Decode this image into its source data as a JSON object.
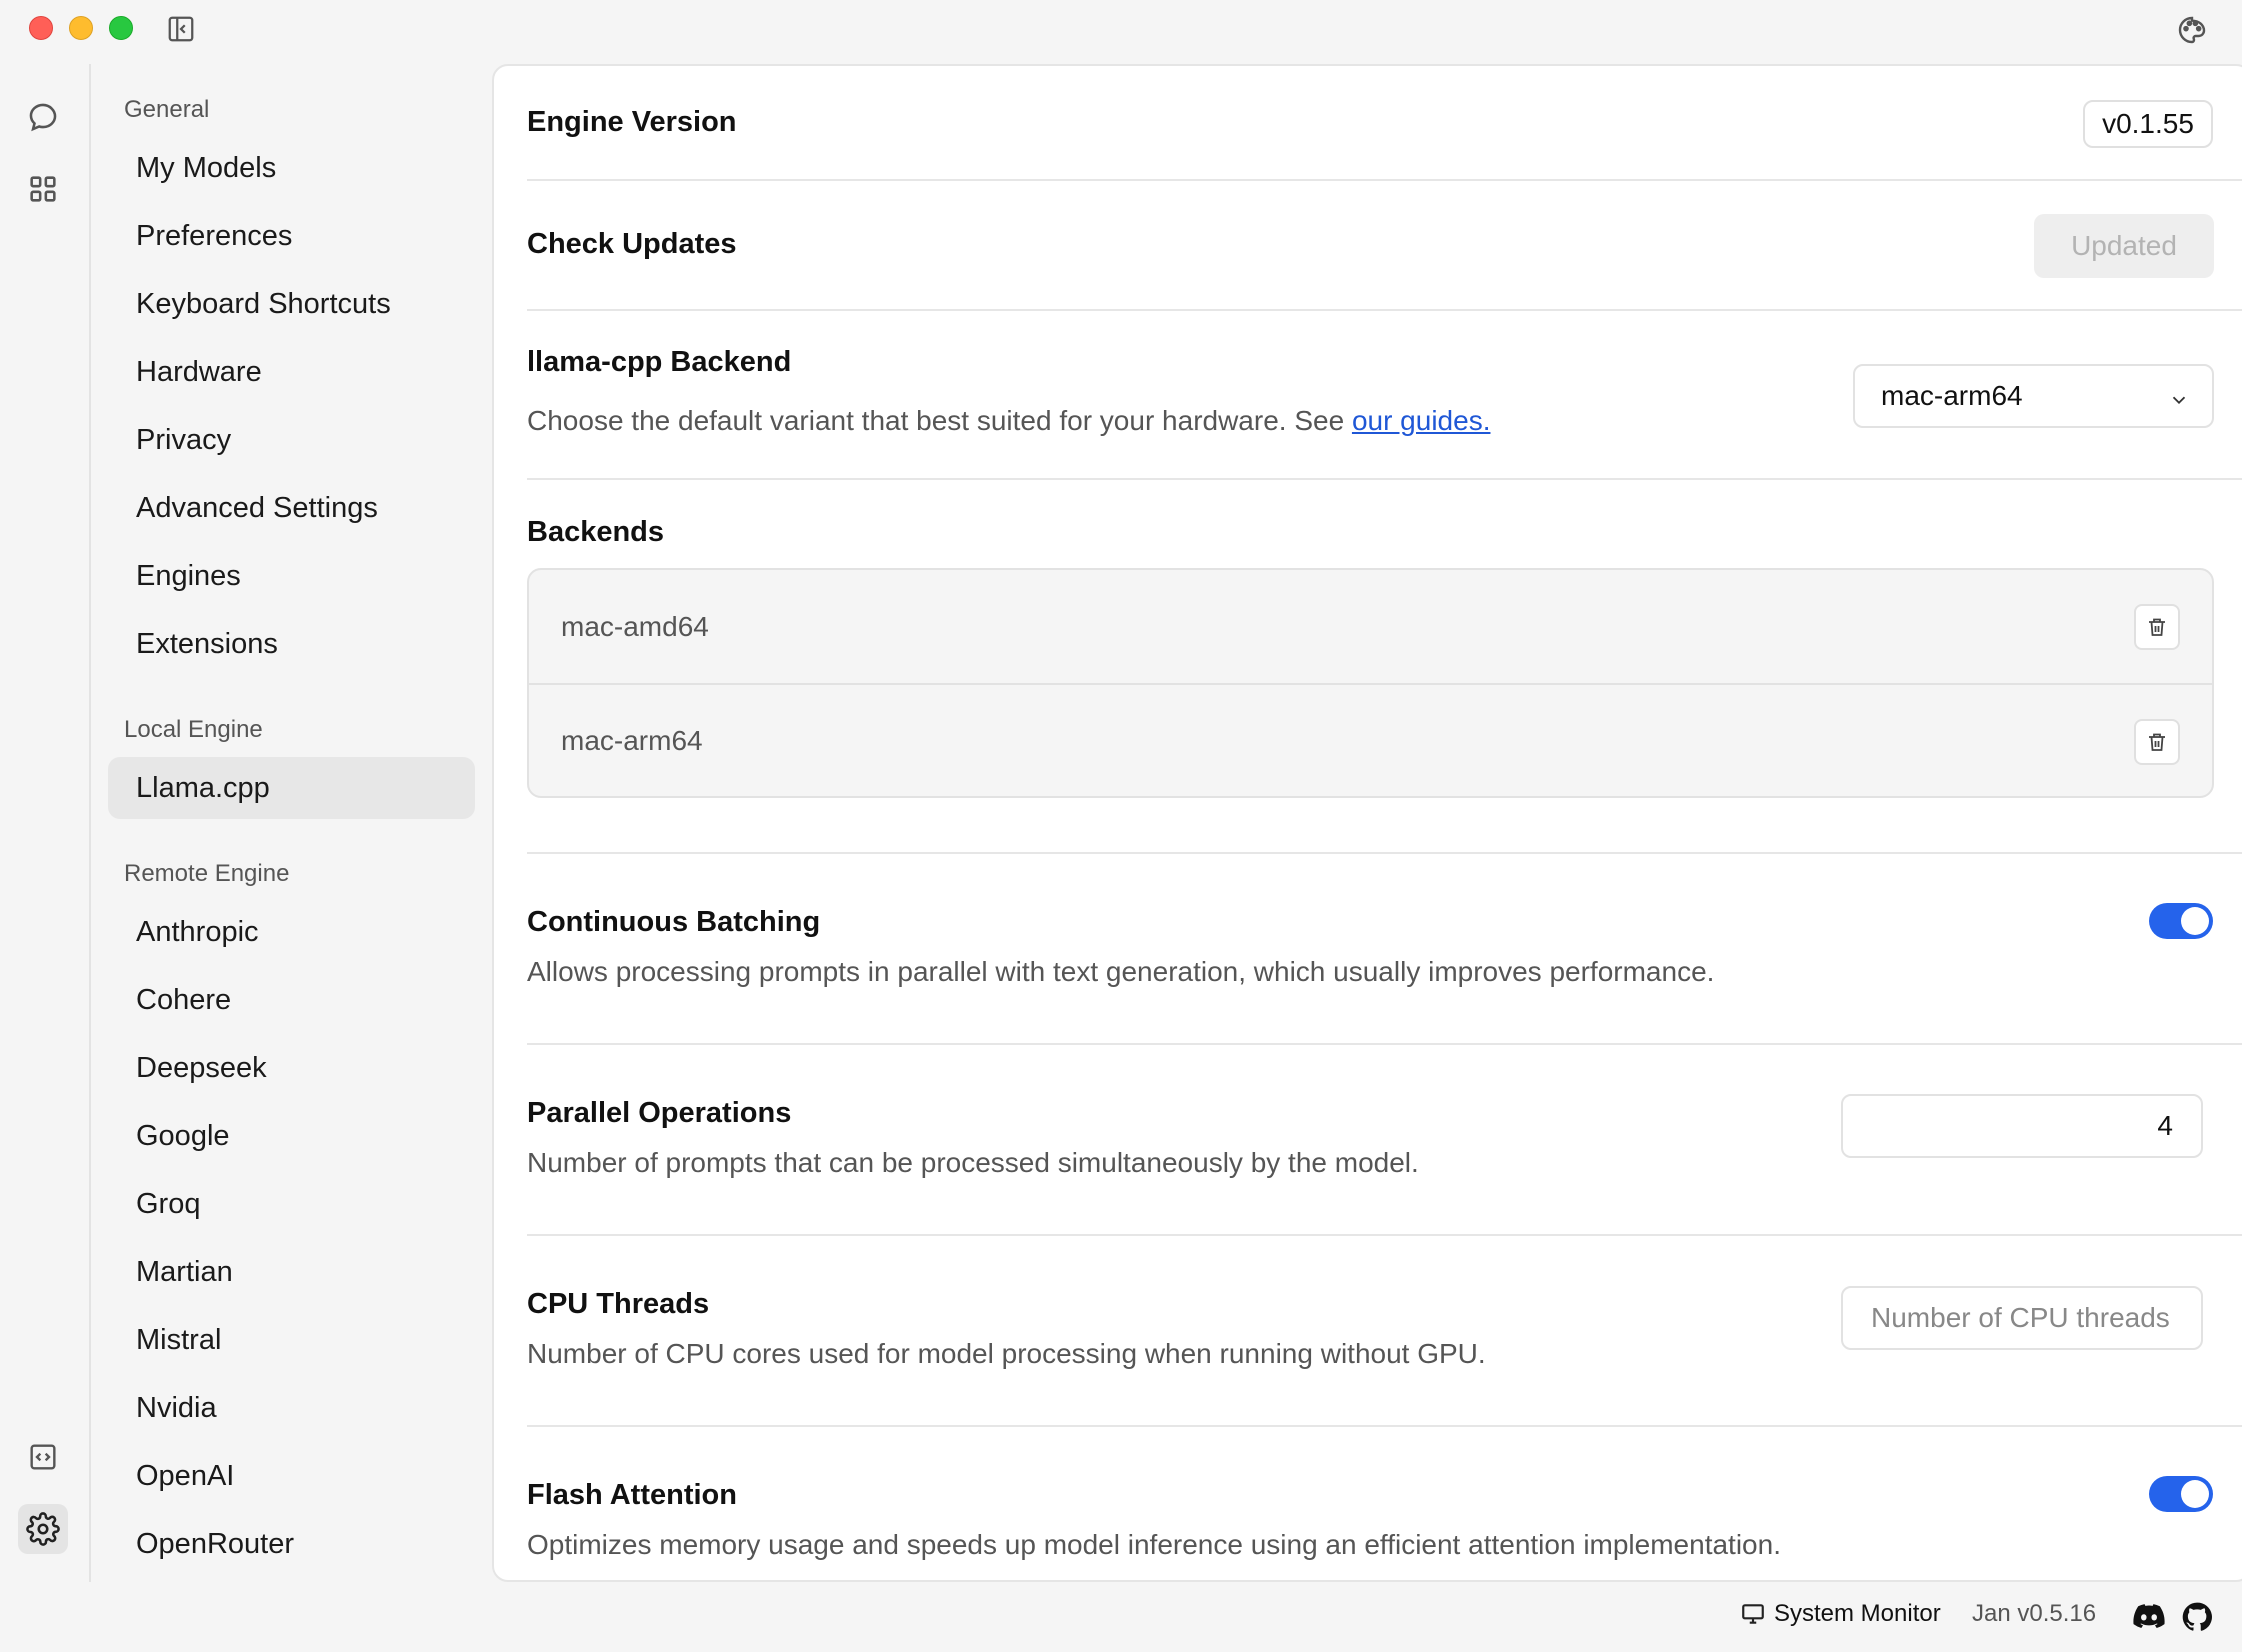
{
  "sidebar": {
    "sections": {
      "general": "General",
      "local_engine": "Local Engine",
      "remote_engine": "Remote Engine"
    },
    "general_items": [
      "My Models",
      "Preferences",
      "Keyboard Shortcuts",
      "Hardware",
      "Privacy",
      "Advanced Settings",
      "Engines",
      "Extensions"
    ],
    "local_items": [
      "Llama.cpp"
    ],
    "remote_items": [
      "Anthropic",
      "Cohere",
      "Deepseek",
      "Google",
      "Groq",
      "Martian",
      "Mistral",
      "Nvidia",
      "OpenAI",
      "OpenRouter"
    ],
    "active_item": "Llama.cpp"
  },
  "settings": {
    "engine_version": {
      "title": "Engine Version",
      "value": "v0.1.55"
    },
    "check_updates": {
      "title": "Check Updates",
      "button": "Updated"
    },
    "backend": {
      "title": "llama-cpp Backend",
      "description": "Choose the default variant that best suited for your hardware. See",
      "link_text": "our guides.",
      "selected": "mac-arm64"
    },
    "backends": {
      "title": "Backends",
      "items": [
        "mac-amd64",
        "mac-arm64"
      ]
    },
    "continuous_batching": {
      "title": "Continuous Batching",
      "description": "Allows processing prompts in parallel with text generation, which usually improves performance.",
      "enabled": true
    },
    "parallel_operations": {
      "title": "Parallel Operations",
      "description": "Number of prompts that can be processed simultaneously by the model.",
      "value": "4"
    },
    "cpu_threads": {
      "title": "CPU Threads",
      "description": "Number of CPU cores used for model processing when running without GPU.",
      "placeholder": "Number of CPU threads"
    },
    "flash_attention": {
      "title": "Flash Attention",
      "description": "Optimizes memory usage and speeds up model inference using an efficient attention implementation.",
      "enabled": true
    }
  },
  "status_bar": {
    "system_monitor": "System Monitor",
    "version": "Jan v0.5.16"
  },
  "icons": {
    "chat": "chat-icon",
    "hub": "grid-icon",
    "api": "code-box-icon",
    "settings": "gear-icon",
    "sidebar_toggle": "sidebar-toggle-icon",
    "theme": "palette-icon",
    "monitor": "monitor-icon",
    "discord": "discord-icon",
    "github": "github-icon"
  },
  "colors": {
    "accent": "#2563eb",
    "link": "#1f57d6"
  }
}
